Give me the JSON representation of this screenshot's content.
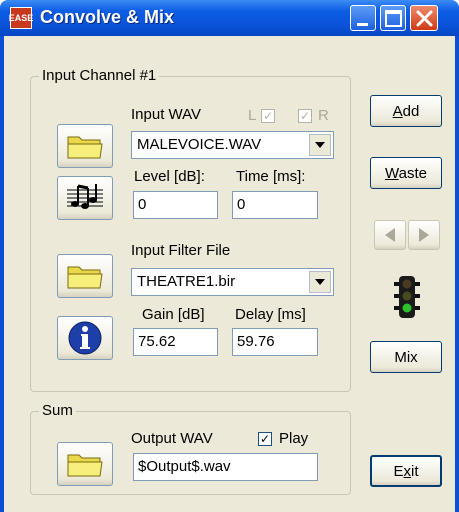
{
  "window": {
    "title": "Convolve & Mix",
    "app_icon": "EASE"
  },
  "input_channel": {
    "group_title": "Input Channel #1",
    "input_wav_label": "Input WAV",
    "left_label": "L",
    "right_label": "R",
    "left_checked": true,
    "right_checked": true,
    "input_wav_value": "MALEVOICE.WAV",
    "level_label": "Level [dB]:",
    "level_value": "0",
    "time_label": "Time [ms]:",
    "time_value": "0",
    "filter_file_label": "Input Filter File",
    "filter_file_value": "THEATRE1.bir",
    "gain_label": "Gain [dB]",
    "gain_value": "75.62",
    "delay_label": "Delay [ms]",
    "delay_value": "59.76"
  },
  "sum": {
    "group_title": "Sum",
    "output_wav_label": "Output WAV",
    "play_label": "Play",
    "play_checked": true,
    "output_wav_value": "$Output$.wav"
  },
  "buttons": {
    "add": {
      "pre": "",
      "key": "A",
      "post": "dd"
    },
    "waste": {
      "pre": "",
      "key": "W",
      "post": "aste"
    },
    "mix": "Mix",
    "exit": {
      "pre": "E",
      "key": "x",
      "post": "it"
    }
  },
  "icons": {
    "folder": "folder-icon",
    "music": "music-notes-icon",
    "info": "info-icon",
    "traffic_light": "traffic-light-icon",
    "prev": "arrow-left-icon",
    "next": "arrow-right-icon"
  },
  "colors": {
    "title_bar": "#0a52d8",
    "dialog_bg": "#ece9d8",
    "folder": "#f5ec6a",
    "info": "#1e3ea8",
    "traffic_green": "#2bc12b"
  }
}
